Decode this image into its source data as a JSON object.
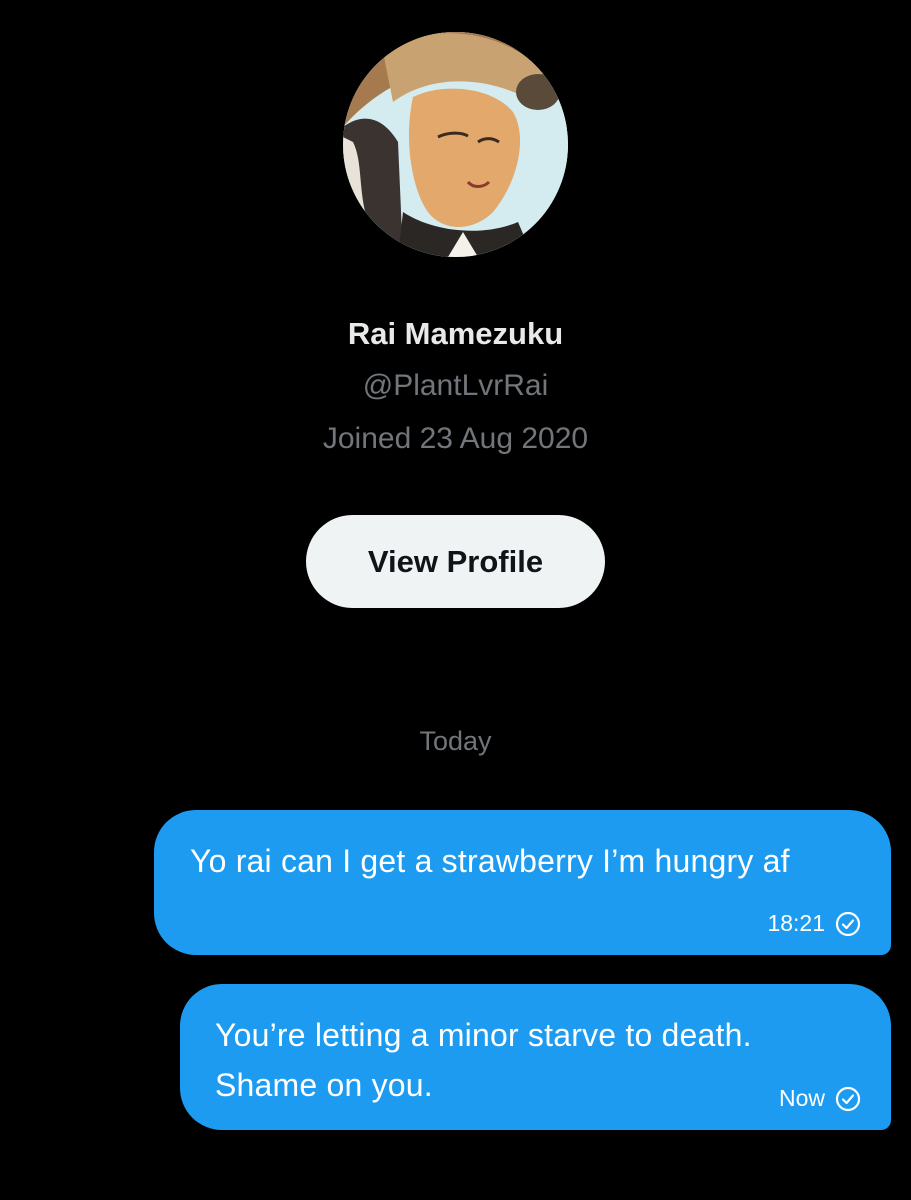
{
  "profile": {
    "name": "Rai Mamezuku",
    "handle": "@PlantLvrRai",
    "joined": "Joined 23 Aug 2020",
    "view_profile_label": "View Profile"
  },
  "conversation": {
    "day_separator": "Today",
    "messages": [
      {
        "text": "Yo rai can I get a strawberry I’m hungry af",
        "time": "18:21",
        "status_icon": "sent-check-icon"
      },
      {
        "text": "You’re letting a minor starve to death. Shame on you.",
        "time": "Now",
        "status_icon": "sent-check-icon"
      }
    ]
  },
  "colors": {
    "background": "#000000",
    "bubble": "#1d9bf0",
    "secondary_text": "#71767b",
    "button_bg": "#eff3f4"
  }
}
